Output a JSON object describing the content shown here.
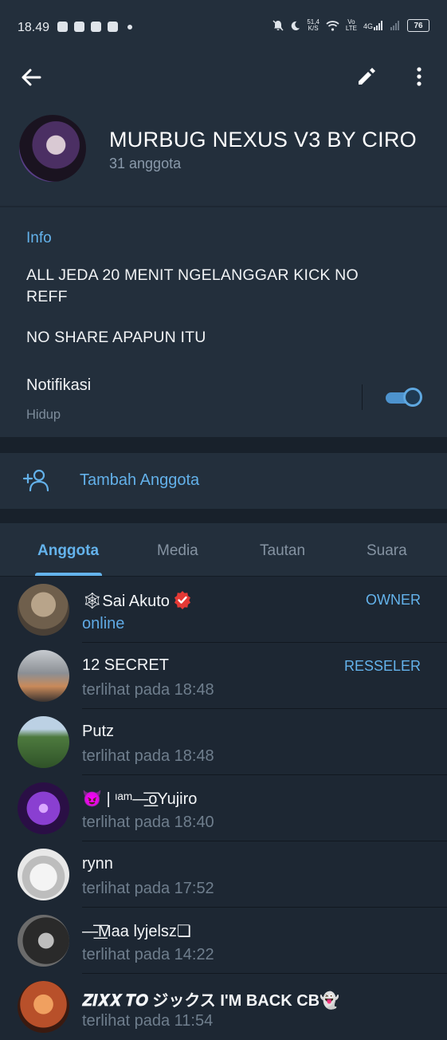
{
  "status_bar": {
    "time": "18.49",
    "net_speed_value": "51,4",
    "net_speed_unit": "K/S",
    "vo_label": "Vo",
    "lte_label": "LTE",
    "net_4g": "4G",
    "battery": "76"
  },
  "header": {
    "group_name": "MURBUG NEXUS V3 BY CIRO",
    "member_count": "31 anggota"
  },
  "info": {
    "label": "Info",
    "description_line1": "ALL JEDA 20 MENIT NGELANGGAR KICK NO",
    "description_line2": "REFF",
    "description_line3": "NO SHARE APAPUN ITU",
    "notification_label": "Notifikasi",
    "notification_status": "Hidup",
    "notification_enabled": true
  },
  "actions": {
    "add_member": "Tambah Anggota"
  },
  "tabs": [
    {
      "label": "Anggota",
      "active": true
    },
    {
      "label": "Media",
      "active": false
    },
    {
      "label": "Tautan",
      "active": false
    },
    {
      "label": "Suara",
      "active": false
    }
  ],
  "members": [
    {
      "name": "🕸Sai Akuto",
      "status": "online",
      "role": "OWNER",
      "verified": true,
      "avatar_color": "#8a7a66"
    },
    {
      "name": "12 SECRET",
      "status": "terlihat pada  18:48",
      "role": "RESSELER",
      "verified": false,
      "avatar_color": "#6c7a86"
    },
    {
      "name": "Putz",
      "status": "terlihat pada  18:48",
      "role": "",
      "verified": false,
      "avatar_color": "#4d7a3e"
    },
    {
      "name": "😈 | ᶦᵃᵐ—͟͟͞͞ᴏYujiro",
      "status": "terlihat pada  18:40",
      "role": "",
      "verified": false,
      "avatar_color": "#5a2b8c"
    },
    {
      "name": "rynn",
      "status": "terlihat pada  17:52",
      "role": "",
      "verified": false,
      "avatar_color": "#d9d9d9"
    },
    {
      "name": "—͟͟͞͞Maa lyjelsz❏",
      "status": "terlihat pada  14:22",
      "role": "",
      "verified": false,
      "avatar_color": "#3a3a3a"
    },
    {
      "name": "𝒁𝑰𝑿𝑿 𝑻𝑶 ジックス I'M BACK CB👻",
      "status": "terlihat pada  11:54",
      "role": "",
      "verified": false,
      "avatar_color": "#b8502a"
    }
  ],
  "colors": {
    "accent": "#64b3ec",
    "background": "#1d2733",
    "card": "#232f3c"
  }
}
